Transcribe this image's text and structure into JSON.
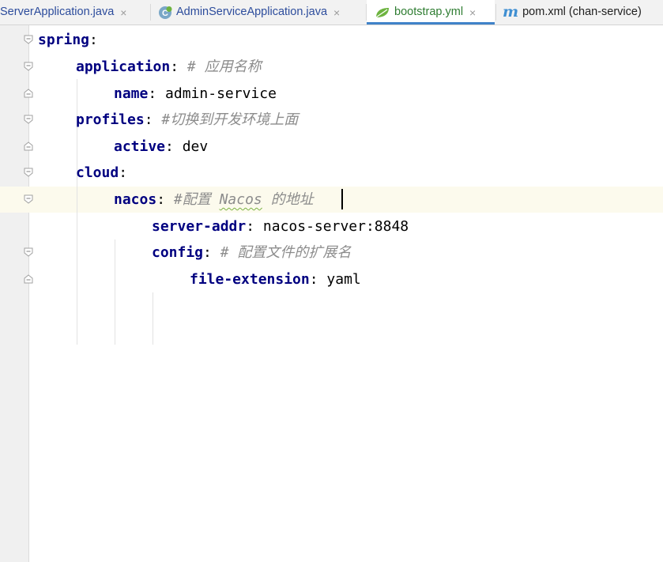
{
  "tabs": [
    {
      "label": "ServerApplication.java",
      "icon": "none",
      "active": false
    },
    {
      "label": "AdminServiceApplication.java",
      "icon": "spring-class-icon",
      "active": false
    },
    {
      "label": "bootstrap.yml",
      "icon": "spring-leaf-icon",
      "active": true
    },
    {
      "label": "pom.xml (chan-service)",
      "icon": "maven-icon",
      "active": false
    }
  ],
  "tab_close_glyph": "×",
  "maven_glyph": "m",
  "colors": {
    "yaml_key": "#000080",
    "comment": "#8c8c8c",
    "active_tab_underline": "#4083c9",
    "caret_line": "#fcfaed",
    "java_tab_text": "#2c4c9c",
    "yml_tab_text": "#2f7d32"
  },
  "editor": {
    "lines": [
      {
        "key": "spring",
        "sep": ":",
        "value": "",
        "comment": ""
      },
      {
        "key": "application",
        "sep": ":",
        "value": "",
        "comment": "# 应用名称"
      },
      {
        "key": "name",
        "sep": ":",
        "value": "admin-service",
        "comment": ""
      },
      {
        "key": "profiles",
        "sep": ":",
        "value": "",
        "comment": "#切换到开发环境上面"
      },
      {
        "key": "active",
        "sep": ":",
        "value": "dev",
        "comment": ""
      },
      {
        "key": "cloud",
        "sep": ":",
        "value": "",
        "comment": ""
      },
      {
        "key": "nacos",
        "sep": ":",
        "value": "",
        "comment_parts": [
          "#配置 ",
          "Nacos",
          " 的地址"
        ]
      },
      {
        "key": "server-addr",
        "sep": ":",
        "value": "nacos-server:8848",
        "comment": ""
      },
      {
        "key": "config",
        "sep": ":",
        "value": "",
        "comment": "# 配置文件的扩展名"
      },
      {
        "key": "file-extension",
        "sep": ":",
        "value": "yaml",
        "comment": ""
      }
    ]
  }
}
